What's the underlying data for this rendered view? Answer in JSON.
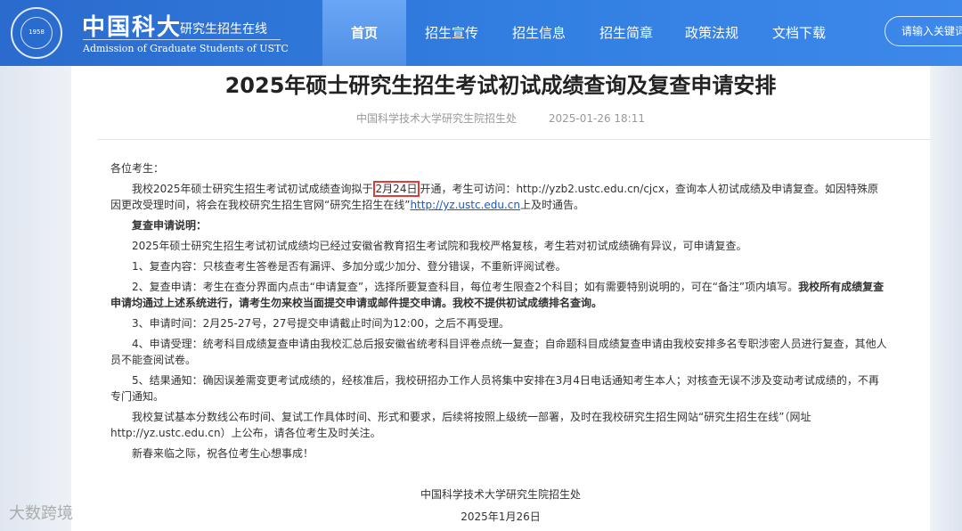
{
  "header": {
    "brand_cn": "中国科大",
    "brand_sub": "研究生招生在线",
    "brand_en": "Admission of Graduate Students of USTC",
    "seal_year": "1958",
    "search_placeholder": "请输入关键词"
  },
  "nav": {
    "items": [
      {
        "label": "首页"
      },
      {
        "label": "招生宣传"
      },
      {
        "label": "招生信息"
      },
      {
        "label": "招生简章"
      },
      {
        "label": "政策法规"
      },
      {
        "label": "文档下载"
      }
    ]
  },
  "article": {
    "title": "2025年硕士研究生招生考试初试成绩查询及复查申请安排",
    "source": "中国科学技术大学研究生院招生处",
    "datetime": "2025-01-26 18:11",
    "greeting": "各位考生：",
    "p1_a": "我校2025年硕士研究生招生考试初试成绩查询拟于",
    "p1_date": "2月24日",
    "p1_b": "开通，考生可访问：http://yzb2.ustc.edu.cn/cjcx，查询本人初试成绩及申请复查。如因特殊原因更改受理时间，将会在我校研究生招生官网“研究生招生在线”",
    "p1_link": "http://yz.ustc.edu.cn",
    "p1_c": "上及时通告。",
    "heading": "复查申请说明：",
    "p2": "2025年硕士研究生招生考试初试成绩均已经过安徽省教育招生考试院和我校严格复核，考生若对初试成绩确有异议，可申请复查。",
    "p3": "1、复查内容：只核查考生答卷是否有漏评、多加分或少加分、登分错误，不重新评阅试卷。",
    "p4_a": "2、复查申请：考生在查分界面内点击“申请复查”，选择所要复查科目，每位考生限查2个科目；如有需要特别说明的，可在“备注”项内填写。",
    "p4_b": "我校所有成绩复查申请均通过上述系统进行，请考生勿来校当面提交申请或邮件提交申请。我校不提供初试成绩排名查询。",
    "p5": "3、申请时间：2月25-27号，27号提交申请截止时间为12:00，之后不再受理。",
    "p6": "4、申请受理：统考科目成绩复查申请由我校汇总后报安徽省统考科目评卷点统一复查；自命题科目成绩复查申请由我校安排多名专职涉密人员进行复查，其他人员不能查阅试卷。",
    "p7": "5、结果通知：确因误差需变更考试成绩的，经核准后，我校研招办工作人员将集中安排在3月4日电话通知考生本人；对核查无误不涉及变动考试成绩的，不再专门通知。",
    "p8": "我校复试基本分数线公布时间、复试工作具体时间、形式和要求，后续将按照上级统一部署，及时在我校研究生招生网站“研究生招生在线”（网址http://yz.ustc.edu.cn）上公布，请各位考生及时关注。",
    "p9": "新春来临之际，祝各位考生心想事成！",
    "sign_org": "中国科学技术大学研究生院招生处",
    "sign_date": "2025年1月26日"
  },
  "watermark": "大数跨境",
  "colors": {
    "header_bg": "#2f74d6",
    "nav_active": "#5b9bf0",
    "highlight_box": "#e53935",
    "link": "#1a56c6"
  }
}
